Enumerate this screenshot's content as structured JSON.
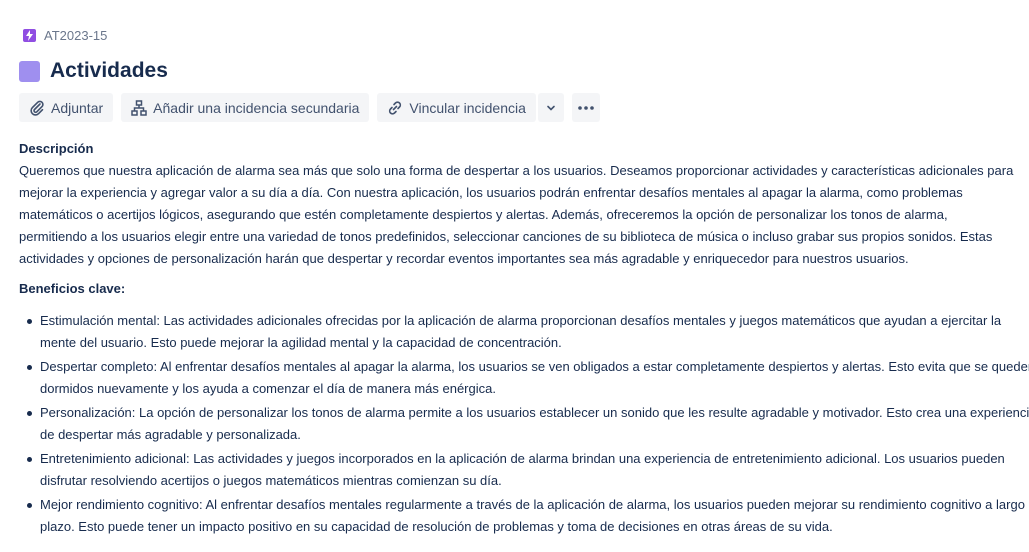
{
  "issue": {
    "key": "AT2023-15",
    "title": "Actividades",
    "epic_color": "#9f8fef",
    "type_icon": "lightning-icon",
    "type_color": "#904ee2"
  },
  "toolbar": {
    "attach_label": "Adjuntar",
    "child_label": "Añadir una incidencia secundaria",
    "link_label": "Vincular incidencia"
  },
  "description": {
    "label": "Descripción",
    "text": "Queremos que nuestra aplicación de alarma sea más que solo una forma de despertar a los usuarios. Deseamos proporcionar actividades y características adicionales para mejorar la experiencia y agregar valor a su día a día. Con nuestra aplicación, los usuarios podrán enfrentar desafíos mentales al apagar la alarma, como problemas matemáticos o acertijos lógicos, asegurando que estén completamente despiertos y alertas. Además, ofreceremos la opción de personalizar los tonos de alarma, permitiendo a los usuarios elegir entre una variedad de tonos predefinidos, seleccionar canciones de su biblioteca de música o incluso grabar sus propios sonidos. Estas actividades y opciones de personalización harán que despertar y recordar eventos importantes sea más agradable y enriquecedor para nuestros usuarios.",
    "benefits_title": "Beneficios clave:",
    "benefits": [
      "Estimulación mental: Las actividades adicionales ofrecidas por la aplicación de alarma proporcionan desafíos mentales y juegos matemáticos que ayudan a ejercitar la mente del usuario. Esto puede mejorar la agilidad mental y la capacidad de concentración.",
      "Despertar completo: Al enfrentar desafíos mentales al apagar la alarma, los usuarios se ven obligados a estar completamente despiertos y alertas. Esto evita que se queden dormidos nuevamente y los ayuda a comenzar el día de manera más enérgica.",
      "Personalización: La opción de personalizar los tonos de alarma permite a los usuarios establecer un sonido que les resulte agradable y motivador. Esto crea una experiencia de despertar más agradable y personalizada.",
      "Entretenimiento adicional: Las actividades y juegos incorporados en la aplicación de alarma brindan una experiencia de entretenimiento adicional. Los usuarios pueden disfrutar resolviendo acertijos o juegos matemáticos mientras comienzan su día.",
      "Mejor rendimiento cognitivo: Al enfrentar desafíos mentales regularmente a través de la aplicación de alarma, los usuarios pueden mejorar su rendimiento cognitivo a largo plazo. Esto puede tener un impacto positivo en su capacidad de resolución de problemas y toma de decisiones en otras áreas de su vida."
    ]
  }
}
